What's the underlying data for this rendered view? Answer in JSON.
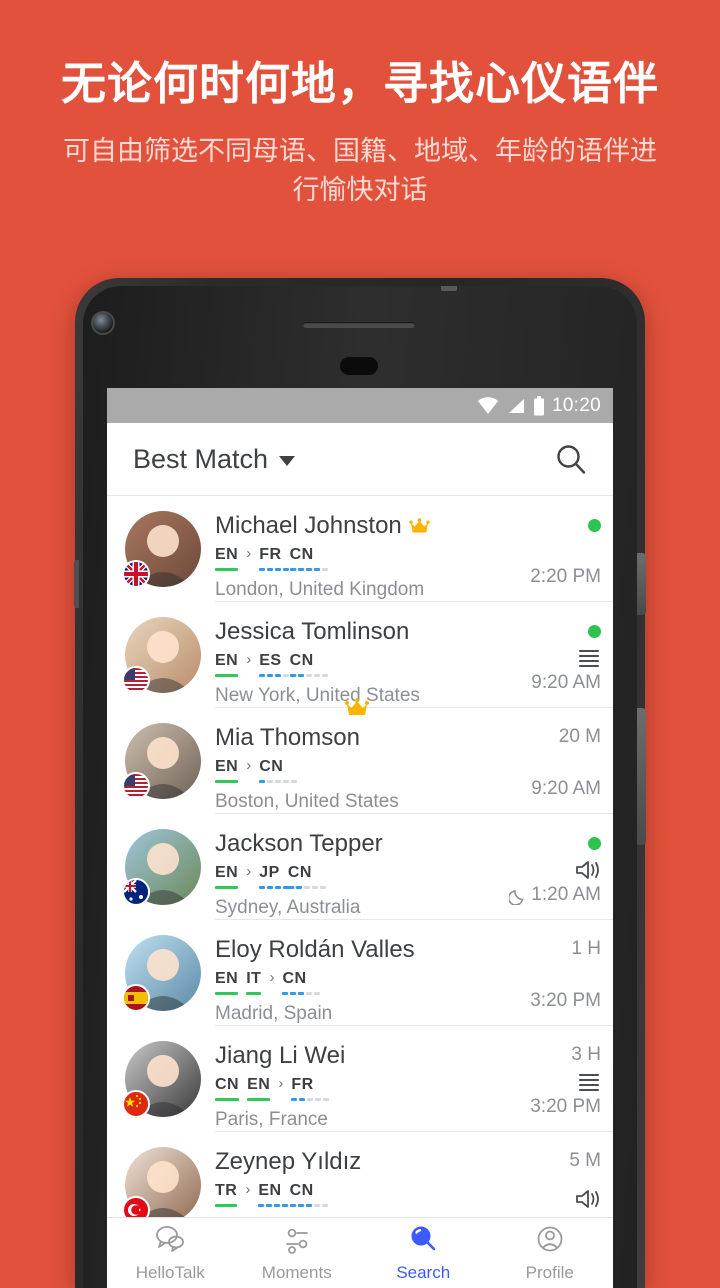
{
  "promo": {
    "title": "无论何时何地，寻找心仪语伴",
    "subtitle": "可自由筛选不同母语、国籍、地域、年龄的语伴进行愉快对话",
    "background_color": "#e2513c"
  },
  "status_bar": {
    "time": "10:20",
    "icons": [
      "wifi-icon",
      "signal-icon",
      "battery-icon"
    ],
    "background_color": "#aaaaaa"
  },
  "app_bar": {
    "title": "Best Match",
    "caret": "chevron-down-icon",
    "search_icon": "search-icon"
  },
  "list": [
    {
      "name": "Michael Johnston",
      "vip": true,
      "languages": [
        {
          "code": "EN",
          "native": true,
          "level": 0
        },
        {
          "code": "FR",
          "native": false,
          "level": 4,
          "after_arrow": true
        },
        {
          "code": "CN",
          "native": false,
          "level": 4
        }
      ],
      "location": "London, United Kingdom",
      "time": "2:20 PM",
      "ago": "",
      "online": true,
      "mode_icon": "",
      "night": false,
      "flag": "gb",
      "crown_below": false
    },
    {
      "name": "Jessica Tomlinson",
      "vip": false,
      "languages": [
        {
          "code": "EN",
          "native": true,
          "level": 0
        },
        {
          "code": "ES",
          "native": false,
          "level": 3,
          "after_arrow": true
        },
        {
          "code": "CN",
          "native": false,
          "level": 2
        }
      ],
      "location": "New York, United States",
      "time": "9:20 AM",
      "ago": "",
      "online": true,
      "mode_icon": "text-lines-icon",
      "night": false,
      "flag": "us",
      "crown_below": true
    },
    {
      "name": "Mia Thomson",
      "vip": false,
      "languages": [
        {
          "code": "EN",
          "native": true,
          "level": 0
        },
        {
          "code": "CN",
          "native": false,
          "level": 1,
          "after_arrow": true
        }
      ],
      "location": "Boston, United States",
      "time": "9:20 AM",
      "ago": "20 M",
      "online": false,
      "mode_icon": "",
      "night": false,
      "flag": "us",
      "crown_below": false
    },
    {
      "name": "Jackson Tepper",
      "vip": false,
      "languages": [
        {
          "code": "EN",
          "native": true,
          "level": 0
        },
        {
          "code": "JP",
          "native": false,
          "level": 4,
          "after_arrow": true
        },
        {
          "code": "CN",
          "native": false,
          "level": 2
        }
      ],
      "location": "Sydney, Australia",
      "time": "1:20 AM",
      "ago": "",
      "online": true,
      "mode_icon": "speaker-icon",
      "night": true,
      "flag": "au",
      "crown_below": false
    },
    {
      "name": "Eloy Roldán Valles",
      "vip": false,
      "languages": [
        {
          "code": "EN",
          "native": true,
          "level": 0
        },
        {
          "code": "IT",
          "native": true,
          "level": 0
        },
        {
          "code": "CN",
          "native": false,
          "level": 3,
          "after_arrow": true
        }
      ],
      "location": "Madrid, Spain",
      "time": "3:20 PM",
      "ago": "1 H",
      "online": false,
      "mode_icon": "",
      "night": false,
      "flag": "es",
      "crown_below": false
    },
    {
      "name": "Jiang Li Wei",
      "vip": false,
      "languages": [
        {
          "code": "CN",
          "native": true,
          "level": 0
        },
        {
          "code": "EN",
          "native": true,
          "level": 0
        },
        {
          "code": "FR",
          "native": false,
          "level": 2,
          "after_arrow": true
        }
      ],
      "location": "Paris, France",
      "time": "3:20 PM",
      "ago": "3 H",
      "online": false,
      "mode_icon": "text-lines-icon",
      "night": false,
      "flag": "cn",
      "crown_below": false
    },
    {
      "name": "Zeynep Yıldız",
      "vip": false,
      "languages": [
        {
          "code": "TR",
          "native": true,
          "level": 0
        },
        {
          "code": "EN",
          "native": false,
          "level": 4,
          "after_arrow": true
        },
        {
          "code": "CN",
          "native": false,
          "level": 3
        }
      ],
      "location": "",
      "time": "",
      "ago": "5 M",
      "online": false,
      "mode_icon": "speaker-icon",
      "night": false,
      "flag": "tr",
      "crown_below": false
    }
  ],
  "tab_bar": {
    "active_color": "#3d5afe",
    "items": [
      {
        "label": "HelloTalk",
        "icon": "chat-bubbles-icon",
        "active": false
      },
      {
        "label": "Moments",
        "icon": "sliders-icon",
        "active": false
      },
      {
        "label": "Search",
        "icon": "search-icon",
        "active": true
      },
      {
        "label": "Profile",
        "icon": "person-icon",
        "active": false
      }
    ]
  }
}
